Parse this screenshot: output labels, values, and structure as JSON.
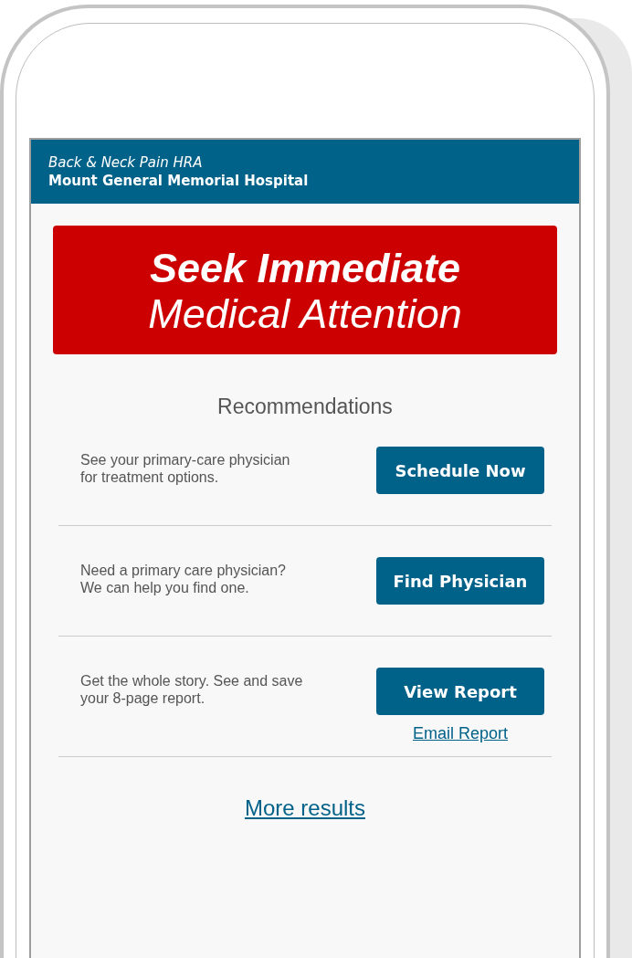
{
  "header": {
    "subtitle": "Back & Neck Pain HRA",
    "organization": "Mount General Memorial Hospital"
  },
  "alert": {
    "lines": [
      "Seek Immediate",
      "Medical Attention"
    ]
  },
  "section_title": "Recommendations",
  "recommendations": [
    {
      "text": "See your primary-care physician for treatment options.",
      "button": "Schedule Now"
    },
    {
      "text": "Need a primary care physician? We can help you find one.",
      "button": "Find Physician"
    },
    {
      "text": "Get the whole story. See and save your 8-page report.",
      "button": "View Report",
      "link": "Email Report"
    }
  ],
  "more_link": "More results"
}
